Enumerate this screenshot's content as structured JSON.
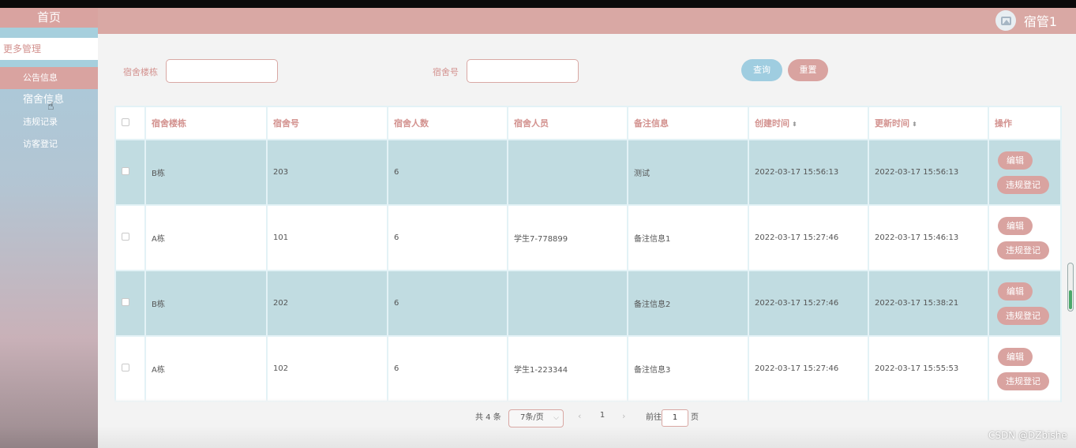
{
  "sidebar": {
    "home": "首页",
    "more": "更多管理",
    "items": [
      {
        "label": "公告信息"
      },
      {
        "label": "宿舍信息"
      },
      {
        "label": "违规记录"
      },
      {
        "label": "访客登记"
      }
    ]
  },
  "header": {
    "user_name": "宿管1",
    "avatar_icon": "image-icon"
  },
  "search": {
    "building_label": "宿舍楼栋",
    "building_value": "",
    "room_label": "宿舍号",
    "room_value": "",
    "query_button": "查询",
    "reset_button": "重置"
  },
  "table": {
    "columns": [
      "宿舍楼栋",
      "宿舍号",
      "宿舍人数",
      "宿舍人员",
      "备注信息",
      "创建时间",
      "更新时间",
      "操作"
    ],
    "rows": [
      {
        "building": "B栋",
        "room": "203",
        "count": "6",
        "members": "",
        "note": "测试",
        "created": "2022-03-17 15:56:13",
        "updated": "2022-03-17 15:56:13"
      },
      {
        "building": "A栋",
        "room": "101",
        "count": "6",
        "members": "学生7-778899",
        "note": "备注信息1",
        "created": "2022-03-17 15:27:46",
        "updated": "2022-03-17 15:46:13"
      },
      {
        "building": "B栋",
        "room": "202",
        "count": "6",
        "members": "",
        "note": "备注信息2",
        "created": "2022-03-17 15:27:46",
        "updated": "2022-03-17 15:38:21"
      },
      {
        "building": "A栋",
        "room": "102",
        "count": "6",
        "members": "学生1-223344",
        "note": "备注信息3",
        "created": "2022-03-17 15:27:46",
        "updated": "2022-03-17 15:55:53"
      }
    ],
    "edit_label": "编辑",
    "violation_label": "违规登记",
    "sort_icon": "sort-icon"
  },
  "pagination": {
    "total": "共 4 条",
    "page_size": "7条/页",
    "current_page": "1",
    "goto_label": "前往",
    "goto_value": "1",
    "page_suffix": "页"
  },
  "watermark": "CSDN @DZbishe",
  "colors": {
    "accent_pink": "#d9a3a0",
    "accent_blue": "#9fcde0",
    "row_highlight": "#c1dce1"
  }
}
